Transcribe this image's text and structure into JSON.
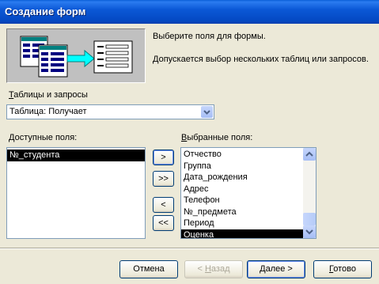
{
  "window": {
    "title": "Создание форм"
  },
  "intro": {
    "line1": "Выберите поля для формы.",
    "line2": "Допускается выбор нескольких таблиц или запросов."
  },
  "tables": {
    "label_first": "Т",
    "label_rest": "аблицы и запросы",
    "selected": "Таблица: Получает"
  },
  "available": {
    "label_first": "Д",
    "label_rest": "оступные поля:",
    "items": [
      "№_студента"
    ],
    "selected_index": 0
  },
  "chosen": {
    "label_first": "В",
    "label_rest": "ыбранные поля:",
    "items": [
      "Отчество",
      "Группа",
      "Дата_рождения",
      "Адрес",
      "Телефон",
      "№_предмета",
      "Период",
      "Оценка"
    ],
    "selected_index": 7
  },
  "move": {
    "add_one": ">",
    "add_all": ">>",
    "remove_one": "<",
    "remove_all": "<<"
  },
  "buttons": {
    "cancel": "Отмена",
    "back_underline": "Н",
    "back_prefix": "< ",
    "back_rest": "азад",
    "next_underline": "Д",
    "next_rest": "алее >",
    "finish_underline": "Г",
    "finish_rest": "отово"
  }
}
